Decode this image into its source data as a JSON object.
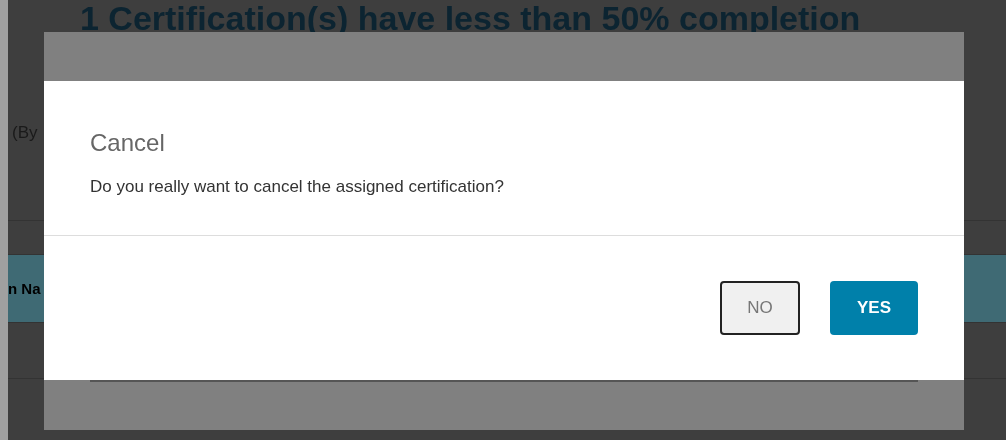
{
  "page": {
    "heading": "1 Certification(s) have less than 50% completion",
    "filter_label": "(By",
    "column_header": "n Na"
  },
  "dialog": {
    "title": "Cancel",
    "message": "Do you really want to cancel the assigned certification?",
    "buttons": [
      {
        "label": "NO",
        "kind": "secondary"
      },
      {
        "label": "YES",
        "kind": "primary"
      }
    ]
  }
}
